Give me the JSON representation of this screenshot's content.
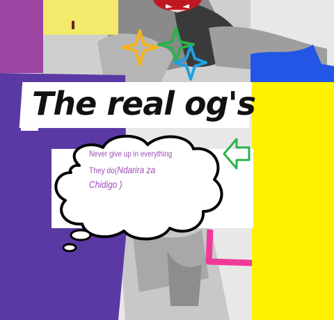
{
  "meme": {
    "title": "The real og's",
    "quote_line1": "Never give up in everything",
    "quote_line2_prefix": "They do(",
    "quote_signature": "Ndarira za Chidigo )"
  },
  "colors": {
    "purple": "#5b39a4",
    "magenta": "#9c45a3",
    "yellow": "#fff200",
    "yellow_pale": "#f3e96a",
    "pink": "#f03a9a",
    "blue": "#2456e6",
    "green": "#2bb24c",
    "text_purple": "#9b4fb5"
  },
  "icons": [
    "sparkle-icon",
    "arrow-left-icon",
    "thought-bubble",
    "devil-face-icon"
  ]
}
